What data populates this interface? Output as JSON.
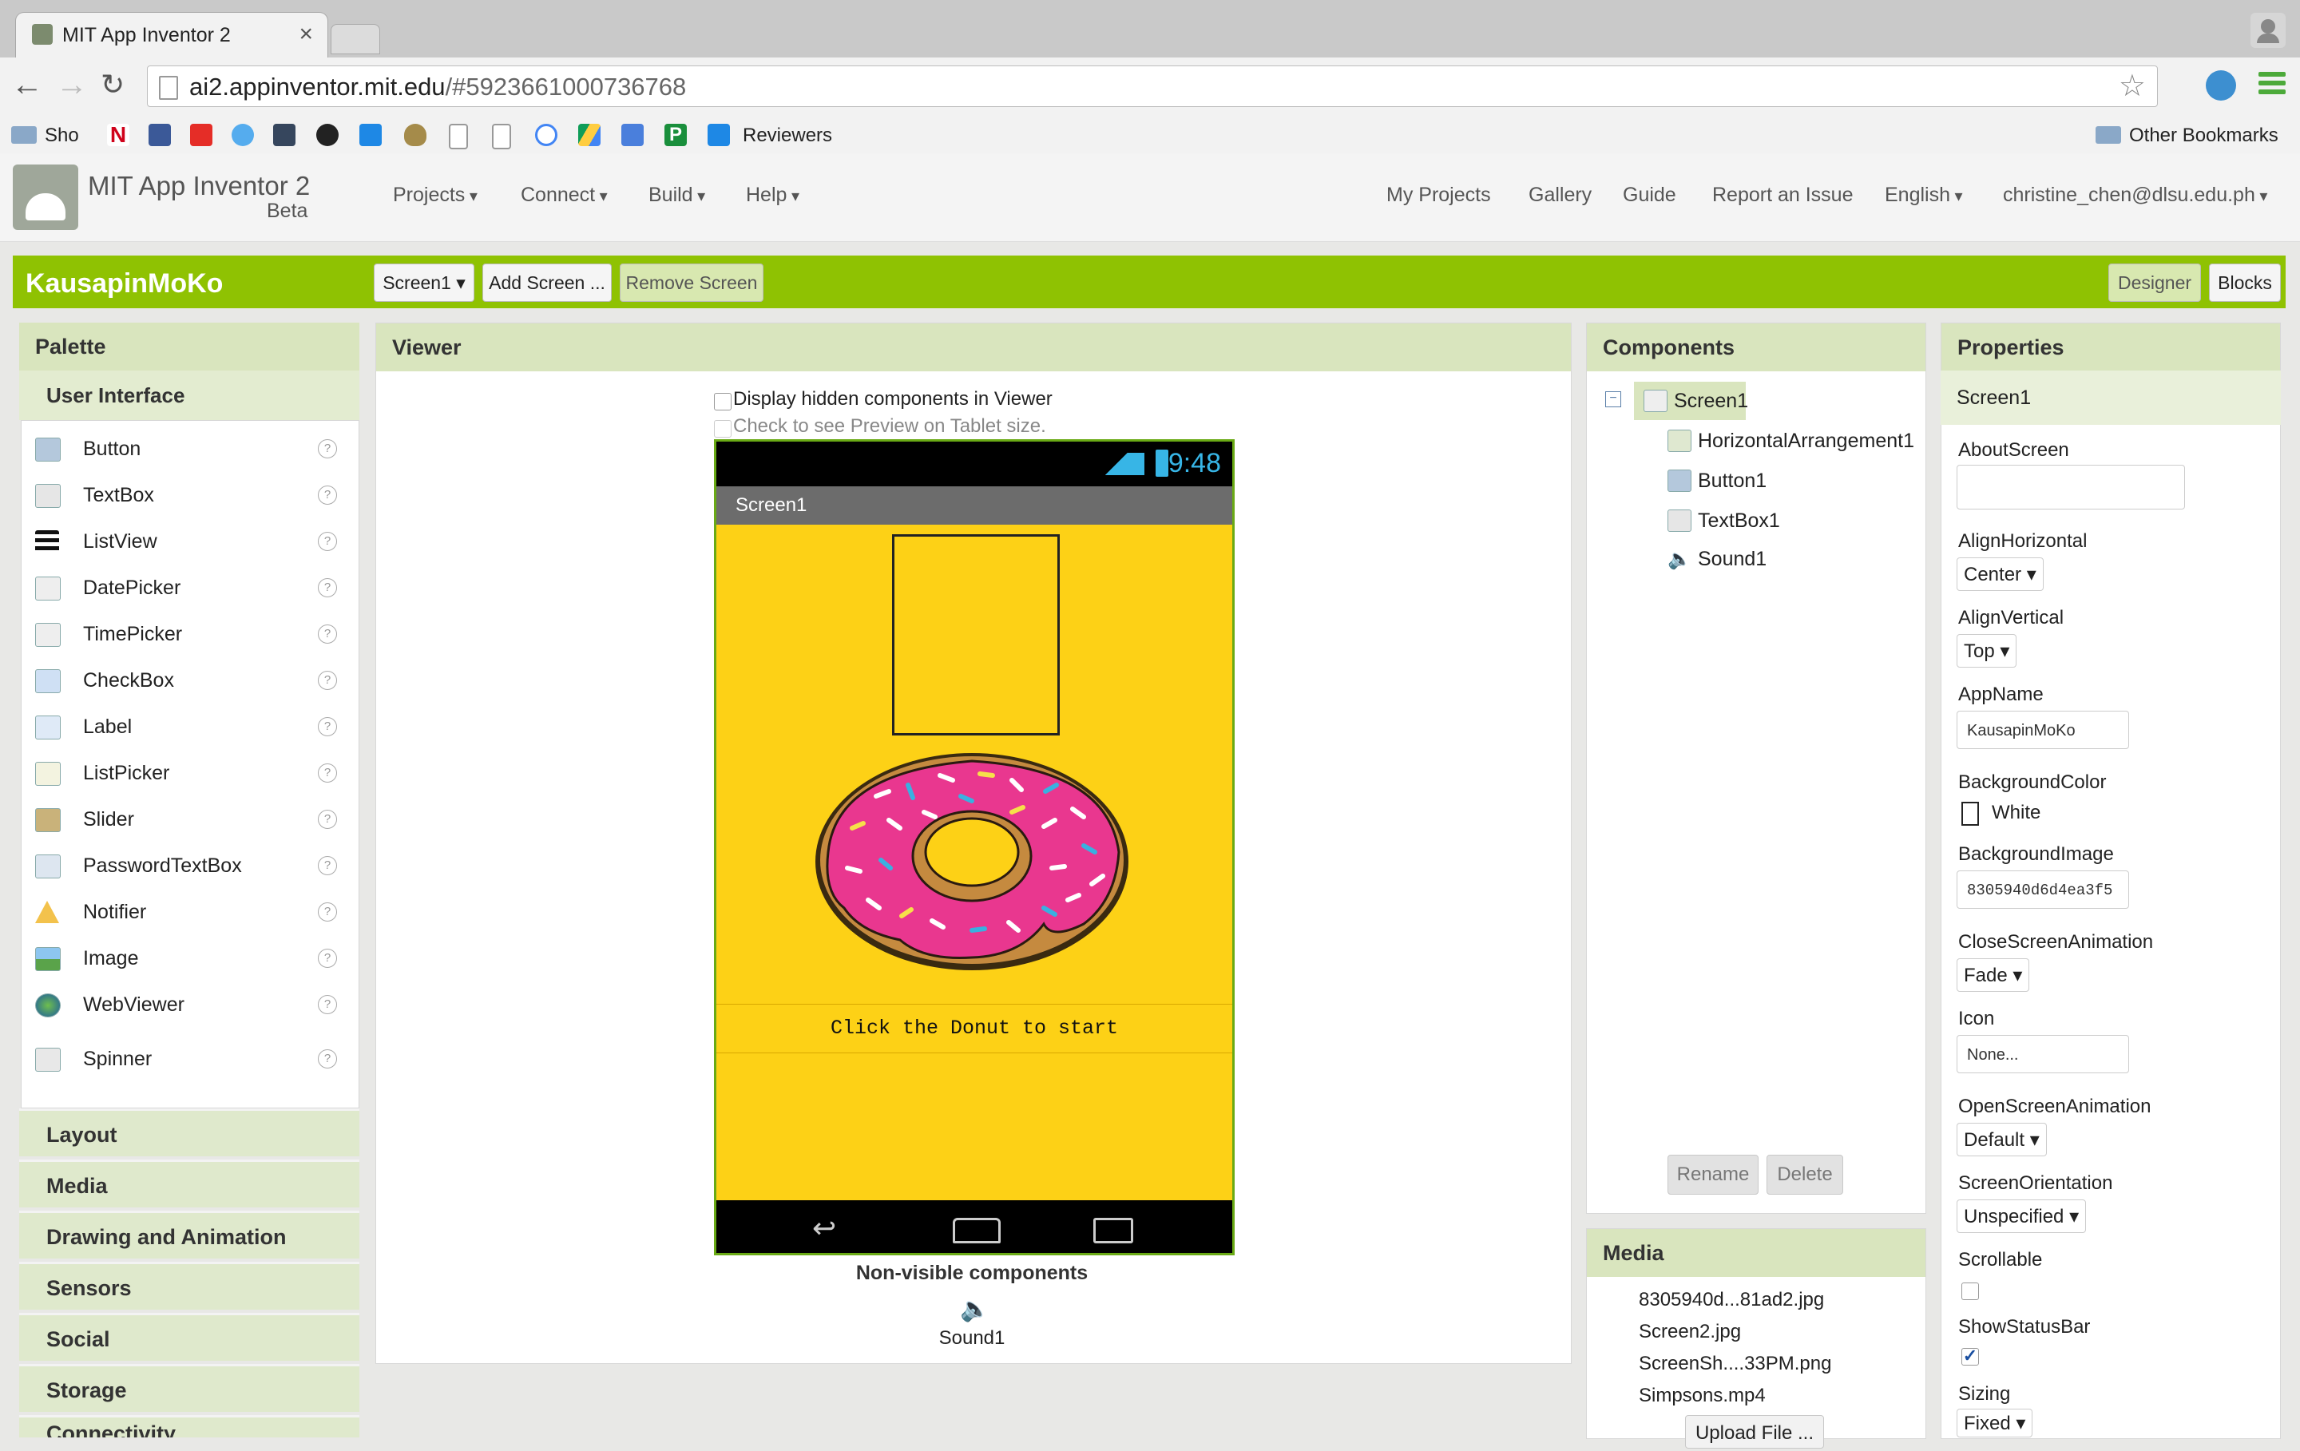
{
  "browser": {
    "tab_title": "MIT App Inventor 2",
    "url_host": "ai2.appinventor.mit.edu",
    "url_path": "/#5923661000736768",
    "bookmarks": {
      "first": "Sho",
      "reviewers": "Reviewers",
      "other": "Other Bookmarks"
    }
  },
  "header": {
    "app_title": "MIT App Inventor 2",
    "beta": "Beta",
    "menus": [
      "Projects",
      "Connect",
      "Build",
      "Help"
    ],
    "links": [
      "My Projects",
      "Gallery",
      "Guide",
      "Report an Issue"
    ],
    "language": "English",
    "user": "christine_chen@dlsu.edu.ph"
  },
  "project": {
    "name": "KausapinMoKo",
    "screen_select": "Screen1",
    "add_screen": "Add Screen ...",
    "remove_screen": "Remove Screen",
    "designer": "Designer",
    "blocks": "Blocks"
  },
  "palette": {
    "title": "Palette",
    "category": "User Interface",
    "items": [
      "Button",
      "TextBox",
      "ListView",
      "DatePicker",
      "TimePicker",
      "CheckBox",
      "Label",
      "ListPicker",
      "Slider",
      "PasswordTextBox",
      "Notifier",
      "Image",
      "WebViewer",
      "Spinner"
    ],
    "categories": [
      "Layout",
      "Media",
      "Drawing and Animation",
      "Sensors",
      "Social",
      "Storage",
      "Connectivity"
    ]
  },
  "viewer": {
    "title": "Viewer",
    "hidden_label": "Display hidden components in Viewer",
    "tablet_label": "Check to see Preview on Tablet size.",
    "time": "9:48",
    "screen_title": "Screen1",
    "button_text": "Click the Donut to start",
    "nonvisible_title": "Non-visible components",
    "nonvisible_item": "Sound1"
  },
  "components": {
    "title": "Components",
    "root": "Screen1",
    "children": [
      "HorizontalArrangement1",
      "Button1",
      "TextBox1",
      "Sound1"
    ],
    "rename": "Rename",
    "delete": "Delete"
  },
  "media": {
    "title": "Media",
    "files": [
      "8305940d...81ad2.jpg",
      "Screen2.jpg",
      "ScreenSh....33PM.png",
      "Simpsons.mp4"
    ],
    "upload": "Upload File ..."
  },
  "properties": {
    "title": "Properties",
    "component": "Screen1",
    "about_label": "AboutScreen",
    "alignh_label": "AlignHorizontal",
    "alignh_value": "Center",
    "alignv_label": "AlignVertical",
    "alignv_value": "Top",
    "appname_label": "AppName",
    "appname_value": "KausapinMoKo",
    "bgcolor_label": "BackgroundColor",
    "bgcolor_value": "White",
    "bgimage_label": "BackgroundImage",
    "bgimage_value": "8305940d6d4ea3f5",
    "close_label": "CloseScreenAnimation",
    "close_value": "Fade",
    "icon_label": "Icon",
    "icon_value": "None...",
    "open_label": "OpenScreenAnimation",
    "open_value": "Default",
    "orient_label": "ScreenOrientation",
    "orient_value": "Unspecified",
    "scroll_label": "Scrollable",
    "statusbar_label": "ShowStatusBar",
    "sizing_label": "Sizing",
    "sizing_value": "Fixed"
  },
  "colors": {
    "accent_green": "#8fc202",
    "phone_bg": "#fdd116",
    "panel_head": "#d9e5be",
    "donut_pink": "#e9378f"
  }
}
